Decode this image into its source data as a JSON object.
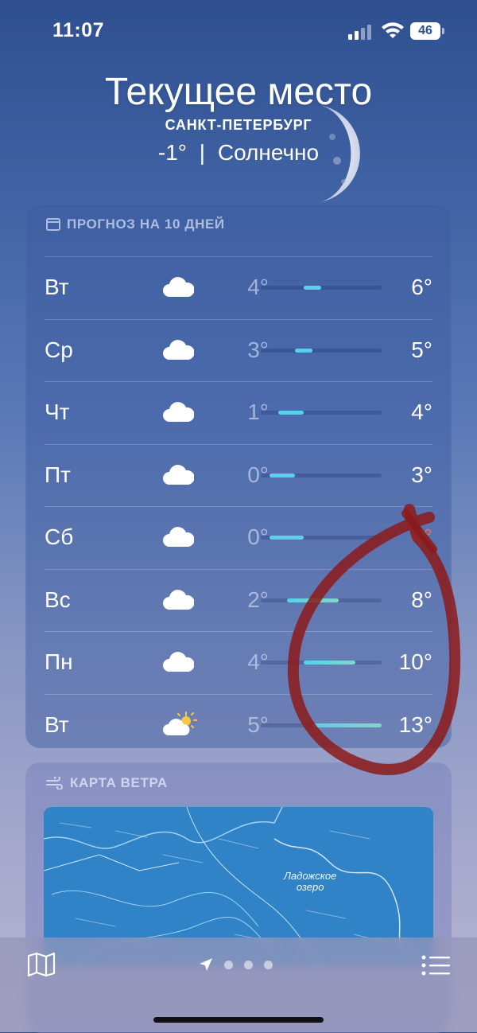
{
  "status_bar": {
    "time": "11:07",
    "battery": "46"
  },
  "header": {
    "location_title": "Текущее место",
    "city": "САНКТ-ПЕТЕРБУРГ",
    "temperature": "-1°",
    "separator": "|",
    "condition": "Солнечно"
  },
  "forecast": {
    "title": "ПРОГНОЗ НА 10 ДНЕЙ",
    "icon": "calendar-icon",
    "range_min": -1,
    "range_max": 13,
    "days": [
      {
        "day": "Вт",
        "icon": "cloud-icon",
        "low": "4°",
        "high": "6°",
        "low_value": 4,
        "high_value": 6
      },
      {
        "day": "Ср",
        "icon": "cloud-icon",
        "low": "3°",
        "high": "5°",
        "low_value": 3,
        "high_value": 5
      },
      {
        "day": "Чт",
        "icon": "cloud-icon",
        "low": "1°",
        "high": "4°",
        "low_value": 1,
        "high_value": 4
      },
      {
        "day": "Пт",
        "icon": "cloud-icon",
        "low": "0°",
        "high": "3°",
        "low_value": 0,
        "high_value": 3
      },
      {
        "day": "Сб",
        "icon": "cloud-icon",
        "low": "0°",
        "high": "4°",
        "low_value": 0,
        "high_value": 4
      },
      {
        "day": "Вс",
        "icon": "cloud-icon",
        "low": "2°",
        "high": "8°",
        "low_value": 2,
        "high_value": 8
      },
      {
        "day": "Пн",
        "icon": "cloud-icon",
        "low": "4°",
        "high": "10°",
        "low_value": 4,
        "high_value": 10
      },
      {
        "day": "Вт",
        "icon": "sun-behind-cloud-icon",
        "low": "5°",
        "high": "13°",
        "low_value": 5,
        "high_value": 13
      }
    ]
  },
  "wind_map": {
    "title": "КАРТА ВЕТРА",
    "icon": "wind-icon",
    "lake_label_line1": "Ладожское",
    "lake_label_line2": "озеро"
  },
  "tab_bar": {
    "left_icon": "map-icon",
    "right_icon": "list-icon",
    "pages": 3
  },
  "colors": {
    "warm_high": "#ef6b55",
    "bar_cool": "#5ad0ea",
    "bar_warm": "#7fd8c8",
    "annotation": "#8c1a1a"
  }
}
